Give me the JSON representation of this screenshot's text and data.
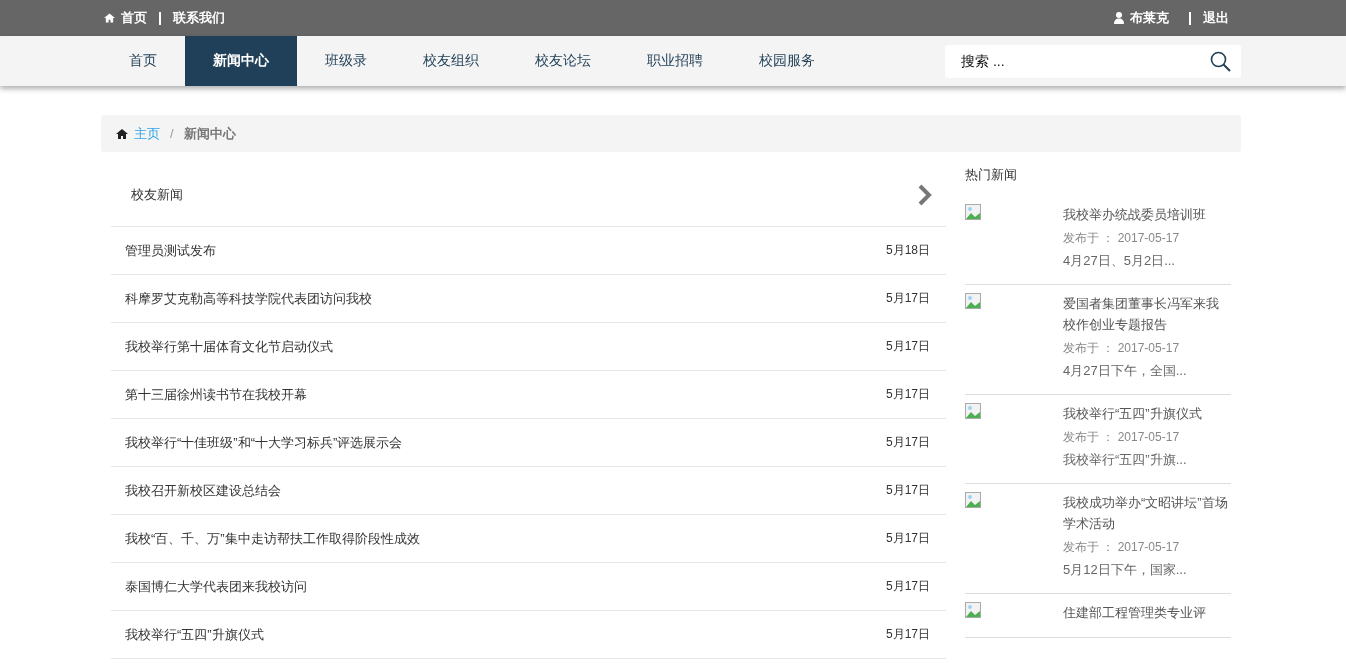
{
  "top_bar": {
    "left_links": [
      "首页",
      "联系我们"
    ],
    "user": "布莱克",
    "logout": "退出"
  },
  "nav": {
    "items": [
      {
        "label": "首页",
        "selected": false
      },
      {
        "label": "新闻中心",
        "selected": true
      },
      {
        "label": "班级录",
        "selected": false
      },
      {
        "label": "校友组织",
        "selected": false
      },
      {
        "label": "校友论坛",
        "selected": false
      },
      {
        "label": "职业招聘",
        "selected": false
      },
      {
        "label": "校园服务",
        "selected": false
      }
    ],
    "search": {
      "placeholder": "搜索 ..."
    }
  },
  "breadcrumb": {
    "home": "主页",
    "separator": "/",
    "current": "新闻中心"
  },
  "news_list": {
    "title": "校友新闻",
    "rows": [
      {
        "title": "管理员测试发布",
        "date": "5月18日"
      },
      {
        "title": "科摩罗艾克勒高等科技学院代表团访问我校",
        "date": "5月17日"
      },
      {
        "title": "我校举行第十届体育文化节启动仪式",
        "date": "5月17日"
      },
      {
        "title": "第十三届徐州读书节在我校开幕",
        "date": "5月17日"
      },
      {
        "title": "我校举行“十佳班级”和“十大学习标兵”评选展示会",
        "date": "5月17日"
      },
      {
        "title": "我校召开新校区建设总结会",
        "date": "5月17日"
      },
      {
        "title": "我校“百、千、万”集中走访帮扶工作取得阶段性成效",
        "date": "5月17日"
      },
      {
        "title": "泰国博仁大学代表团来我校访问",
        "date": "5月17日"
      },
      {
        "title": "我校举行“五四”升旗仪式",
        "date": "5月17日"
      }
    ]
  },
  "hot_news": {
    "title": "热门新闻",
    "items": [
      {
        "title": "我校举办统战委员培训班",
        "published": "发布于 ： 2017-05-17",
        "summary": "4月27日、5月2日..."
      },
      {
        "title": "爱国者集团董事长冯军来我校作创业专题报告",
        "published": "发布于 ： 2017-05-17",
        "summary": "4月27日下午，全国..."
      },
      {
        "title": "我校举行“五四”升旗仪式",
        "published": "发布于 ： 2017-05-17",
        "summary": "我校举行“五四”升旗..."
      },
      {
        "title": "我校成功举办“文昭讲坛”首场学术活动",
        "published": "发布于 ： 2017-05-17",
        "summary": "5月12日下午，国家..."
      },
      {
        "title": "住建部工程管理类专业评"
      }
    ]
  }
}
